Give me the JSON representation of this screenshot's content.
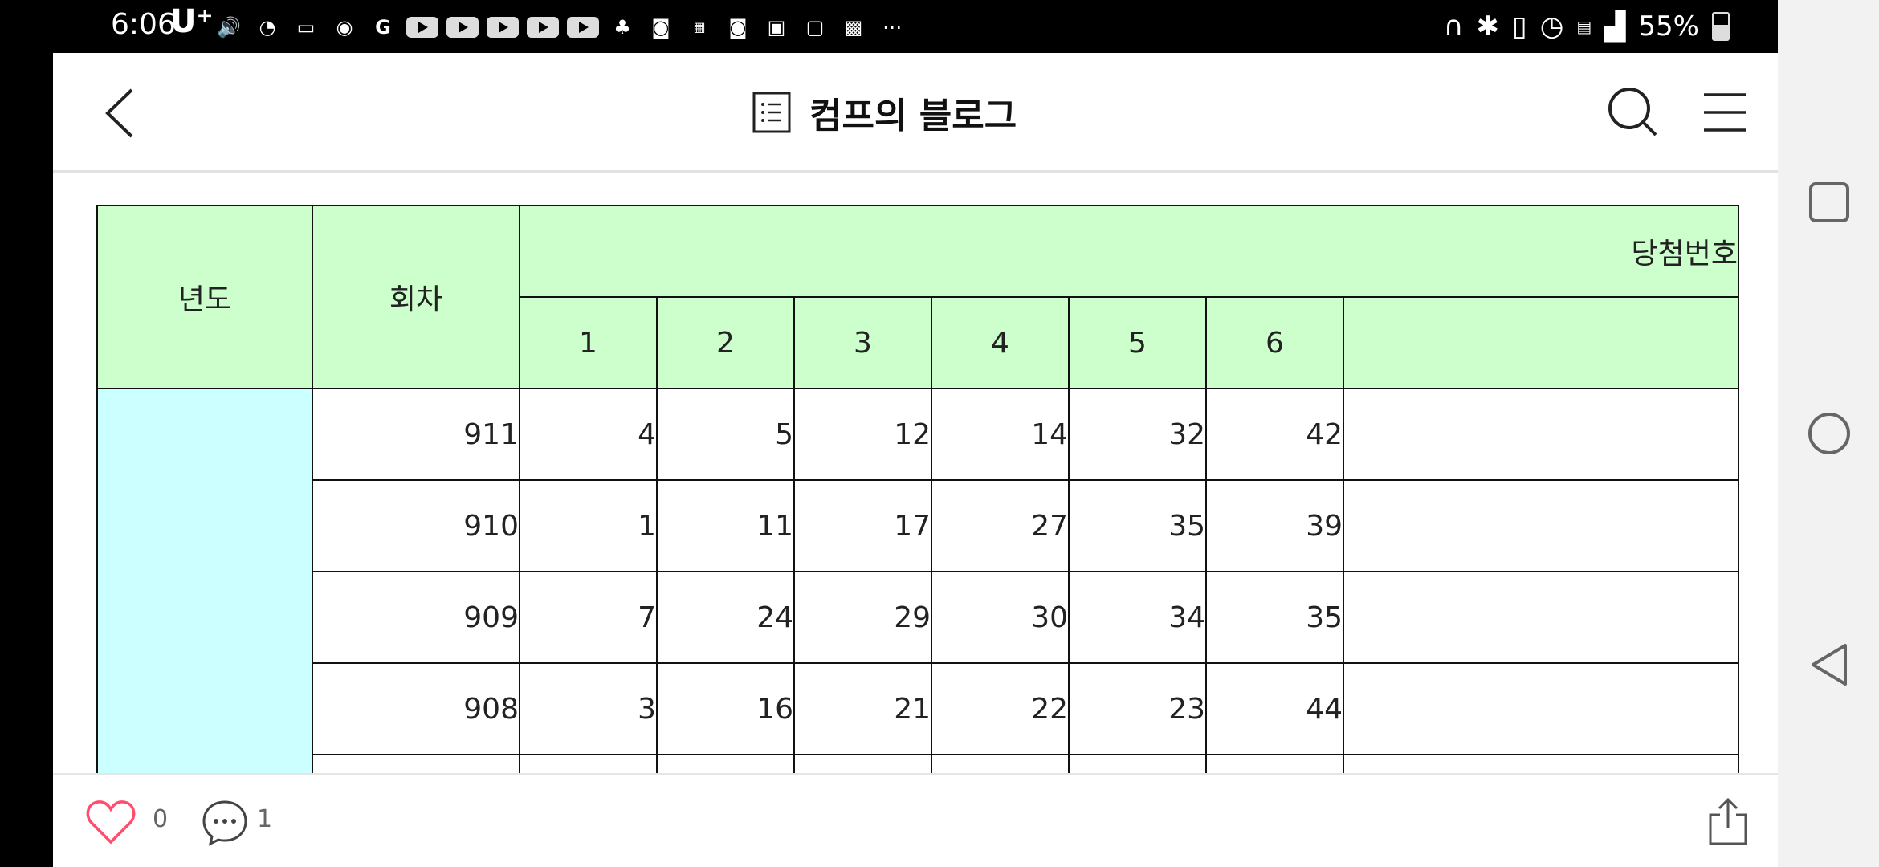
{
  "status": {
    "time": "6:06",
    "carrier": "U⁺",
    "battery": "55%",
    "left_icons": [
      "volume-icon",
      "data-saver-icon",
      "message-icon",
      "location-icon",
      "google-icon",
      "youtube-icon",
      "youtube-icon",
      "youtube-icon",
      "youtube-icon",
      "youtube-icon",
      "cluster-icon",
      "shopping-bag-icon",
      "gs25-icon",
      "shopping-bag-icon",
      "japanese-keyboard-icon",
      "font-icon",
      "w-app-icon",
      "more-icon"
    ],
    "right_icons": [
      "headset-icon",
      "bluetooth-icon",
      "nfc-icon",
      "alarm-icon",
      "5g-icon",
      "signal-icon"
    ]
  },
  "header": {
    "title": "컴프의 블로그"
  },
  "table": {
    "col_year": "년도",
    "col_round": "회차",
    "col_winning": "당첨번호",
    "num_headers": [
      "1",
      "2",
      "3",
      "4",
      "5",
      "6"
    ],
    "rows": [
      {
        "round": "911",
        "nums": [
          "4",
          "5",
          "12",
          "14",
          "32",
          "42"
        ]
      },
      {
        "round": "910",
        "nums": [
          "1",
          "11",
          "17",
          "27",
          "35",
          "39"
        ]
      },
      {
        "round": "909",
        "nums": [
          "7",
          "24",
          "29",
          "30",
          "34",
          "35"
        ]
      },
      {
        "round": "908",
        "nums": [
          "3",
          "16",
          "21",
          "22",
          "23",
          "44"
        ]
      }
    ]
  },
  "footer": {
    "likes": "0",
    "comments": "1"
  },
  "colors": {
    "header_bg": "#ccffcc",
    "year_bg": "#ccffff",
    "like": "#ff4d6d"
  }
}
